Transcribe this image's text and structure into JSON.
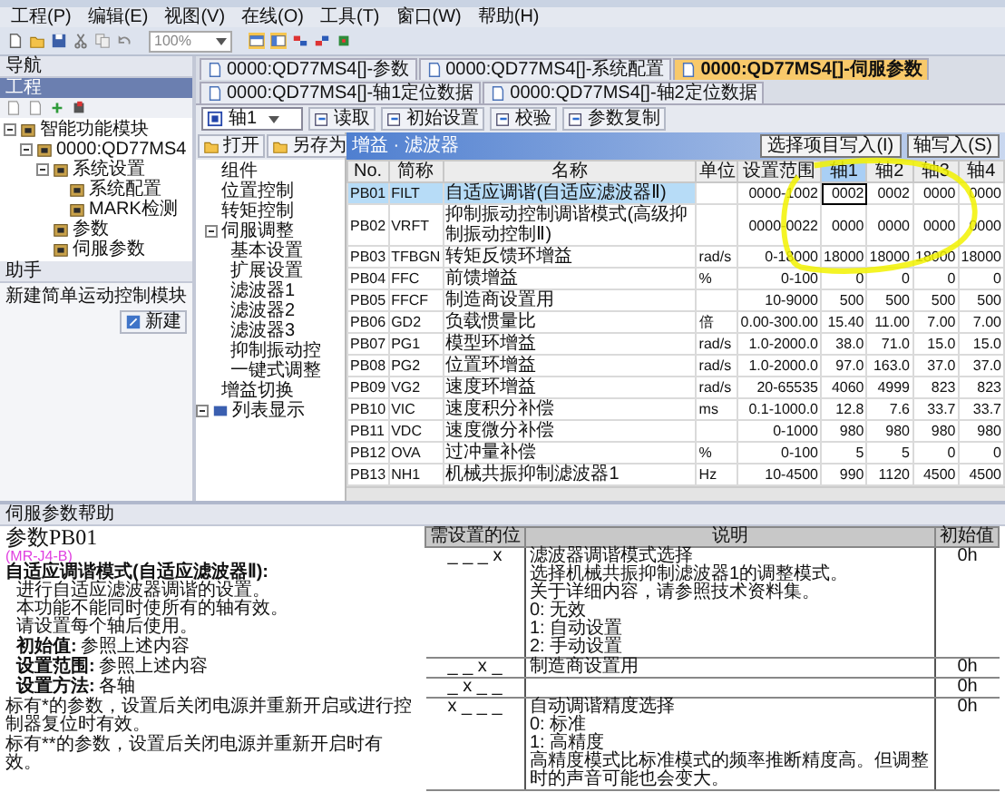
{
  "menu": [
    "工程(P)",
    "编辑(E)",
    "视图(V)",
    "在线(O)",
    "工具(T)",
    "窗口(W)",
    "帮助(H)"
  ],
  "toolbar": {
    "zoom": "100%"
  },
  "navigator": {
    "title": "导航",
    "section": "工程",
    "tree": [
      {
        "label": "智能功能模块",
        "expanded": true,
        "children": [
          {
            "label": "0000:QD77MS4",
            "expanded": true,
            "children": [
              {
                "label": "系统设置",
                "expanded": true,
                "children": [
                  {
                    "label": "系统配置"
                  },
                  {
                    "label": "MARK检测"
                  }
                ]
              },
              {
                "label": "参数"
              },
              {
                "label": "伺服参数"
              }
            ]
          }
        ]
      }
    ]
  },
  "assistant": {
    "title": "助手",
    "text": "新建简单运动控制模块",
    "button": "新建"
  },
  "tabs": [
    {
      "label": "0000:QD77MS4[]-参数",
      "selected": false
    },
    {
      "label": "0000:QD77MS4[]-系统配置",
      "selected": false
    },
    {
      "label": "0000:QD77MS4[]-伺服参数",
      "selected": true
    },
    {
      "label": "0000:QD77MS4[]-轴1定位数据",
      "selected": false
    },
    {
      "label": "0000:QD77MS4[]-轴2定位数据",
      "selected": false
    }
  ],
  "doc_toolbar": {
    "axis": "轴1",
    "buttons": [
      "读取",
      "初始设置",
      "校验",
      "参数复制"
    ],
    "file_buttons": [
      "打开",
      "另存为"
    ]
  },
  "category_tree": [
    {
      "label": "组件"
    },
    {
      "label": "位置控制"
    },
    {
      "label": "转矩控制"
    },
    {
      "label": "伺服调整",
      "expanded": true,
      "children": [
        {
          "label": "基本设置"
        },
        {
          "label": "扩展设置"
        },
        {
          "label": "滤波器1"
        },
        {
          "label": "滤波器2"
        },
        {
          "label": "滤波器3"
        },
        {
          "label": "抑制振动控"
        },
        {
          "label": "一键式调整"
        }
      ]
    },
    {
      "label": "增益切换"
    }
  ],
  "list_view": {
    "label": "列表显示",
    "expanded": true
  },
  "table": {
    "title": "增益 · 滤波器",
    "buttons": [
      "选择项目写入(I)",
      "轴写入(S)"
    ],
    "columns": [
      "No.",
      "简称",
      "名称",
      "单位",
      "设置范围"
    ],
    "axes": [
      {
        "label": "轴1",
        "selected": true
      },
      {
        "label": "轴2",
        "selected": false
      },
      {
        "label": "轴3",
        "selected": false
      },
      {
        "label": "轴4",
        "selected": false
      }
    ],
    "rows": [
      {
        "no": "PB01",
        "abbr": "FILT",
        "name": "自适应调谐(自适应滤波器Ⅱ)",
        "range": "0000-1002",
        "values": [
          "0002",
          "0002",
          "0000",
          "0000"
        ],
        "selected": true
      },
      {
        "no": "PB02",
        "abbr": "VRFT",
        "name": "抑制振动控制调谐模式(高级抑制振动控制Ⅱ)",
        "range": "0000-0022",
        "values": [
          "0000",
          "0000",
          "0000",
          "0000"
        ],
        "selected": false
      },
      {
        "no": "PB03",
        "abbr": "TFBGN",
        "name": "转矩反馈环增益",
        "unit": "rad/s",
        "range": "0-18000",
        "values": [
          "18000",
          "18000",
          "18000",
          "18000"
        ],
        "selected": false
      },
      {
        "no": "PB04",
        "abbr": "FFC",
        "name": "前馈增益",
        "unit": "%",
        "range": "0-100",
        "values": [
          "0",
          "0",
          "0",
          "0"
        ],
        "selected": false
      },
      {
        "no": "PB05",
        "abbr": "FFCF",
        "name": "制造商设置用",
        "range": "10-9000",
        "values": [
          "500",
          "500",
          "500",
          "500"
        ],
        "selected": false
      },
      {
        "no": "PB06",
        "abbr": "GD2",
        "name": "负载惯量比",
        "unit": "倍",
        "range": "0.00-300.00",
        "values": [
          "15.40",
          "11.00",
          "7.00",
          "7.00"
        ],
        "selected": false
      },
      {
        "no": "PB07",
        "abbr": "PG1",
        "name": "模型环增益",
        "unit": "rad/s",
        "range": "1.0-2000.0",
        "values": [
          "38.0",
          "71.0",
          "15.0",
          "15.0"
        ],
        "selected": false
      },
      {
        "no": "PB08",
        "abbr": "PG2",
        "name": "位置环增益",
        "unit": "rad/s",
        "range": "1.0-2000.0",
        "values": [
          "97.0",
          "163.0",
          "37.0",
          "37.0"
        ],
        "selected": false
      },
      {
        "no": "PB09",
        "abbr": "VG2",
        "name": "速度环增益",
        "unit": "rad/s",
        "range": "20-65535",
        "values": [
          "4060",
          "4999",
          "823",
          "823"
        ],
        "selected": false
      },
      {
        "no": "PB10",
        "abbr": "VIC",
        "name": "速度积分补偿",
        "unit": "ms",
        "range": "0.1-1000.0",
        "values": [
          "12.8",
          "7.6",
          "33.7",
          "33.7"
        ],
        "selected": false
      },
      {
        "no": "PB11",
        "abbr": "VDC",
        "name": "速度微分补偿",
        "range": "0-1000",
        "values": [
          "980",
          "980",
          "980",
          "980"
        ],
        "selected": false
      },
      {
        "no": "PB12",
        "abbr": "OVA",
        "name": "过冲量补偿",
        "unit": "%",
        "range": "0-100",
        "values": [
          "5",
          "5",
          "0",
          "0"
        ],
        "selected": false
      },
      {
        "no": "PB13",
        "abbr": "NH1",
        "name": "机械共振抑制滤波器1",
        "unit": "Hz",
        "range": "10-4500",
        "values": [
          "990",
          "1120",
          "4500",
          "4500"
        ],
        "selected": false
      }
    ]
  },
  "help": {
    "title": "伺服参数帮助",
    "param": "参数PB01",
    "model": "(MR-J4-B)",
    "heading": "自适应调谐模式(自适应滤波器Ⅱ):",
    "lines": [
      "进行自适应滤波器调谐的设置。",
      "本功能不能同时使所有的轴有效。",
      "请设置每个轴后使用。"
    ],
    "table": {
      "columns": [
        "需设置的位",
        "说明",
        "初始值"
      ],
      "rows": [
        {
          "bit": "_ _ _ x",
          "lines": [
            "滤波器调谐模式选择",
            "选择机械共振抑制滤波器1的调整模式。",
            "关于详细内容，请参照技术资料集。",
            "0:  无效",
            "1:  自动设置",
            "2:  手动设置"
          ],
          "initial": "0h"
        },
        {
          "bit": "_ _ x _",
          "lines": [
            "制造商设置用"
          ],
          "initial": "0h"
        },
        {
          "bit": "_ x _ _",
          "initial": "0h"
        },
        {
          "bit": "x _ _ _",
          "lines": [
            "自动调谐精度选择",
            "0:  标准",
            "1:  高精度",
            "高精度模式比标准模式的频率推断精度高。但调整时的声音可能也会变大。"
          ],
          "initial": "0h"
        }
      ]
    },
    "fields": [
      {
        "label": "初始值:",
        "value": "参照上述内容"
      },
      {
        "label": "设置范围:",
        "value": "参照上述内容"
      },
      {
        "label": "设置方法:",
        "value": "各轴"
      }
    ],
    "notes": [
      "标有*的参数，设置后关闭电源并重新开启或进行控制器复位时有效。",
      "标有**的参数，设置后关闭电源并重新开启时有效。"
    ]
  }
}
